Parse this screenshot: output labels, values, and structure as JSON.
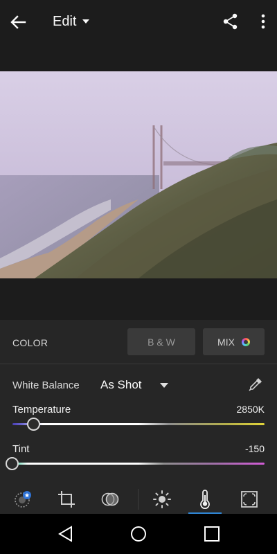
{
  "header": {
    "title": "Edit"
  },
  "icons": {
    "back": "arrow-left-icon",
    "title_dropdown": "caret-down-icon",
    "share": "share-icon",
    "more": "more-vertical-icon",
    "eyedropper": "eyedropper-icon",
    "nav_back": "triangle-back-icon",
    "nav_home": "circle-home-icon",
    "nav_recents": "square-recents-icon"
  },
  "color_panel": {
    "label": "COLOR",
    "bw_button": "B & W",
    "mix_button": "MIX"
  },
  "white_balance": {
    "label": "White Balance",
    "value": "As Shot"
  },
  "sliders": {
    "temperature": {
      "label": "Temperature",
      "value": "2850K",
      "position": 0.08
    },
    "tint": {
      "label": "Tint",
      "value": "-150",
      "position": 0.0
    }
  },
  "toolbar": {
    "items": [
      "auto-icon",
      "crop-icon",
      "selective-icon",
      "light-icon",
      "color-temperature-icon",
      "effects-icon"
    ],
    "active": "color-temperature-icon"
  },
  "colors": {
    "background": "#1c1c1c",
    "panel": "#262626",
    "button": "#3a3a3a",
    "accent": "#2f86d6"
  }
}
